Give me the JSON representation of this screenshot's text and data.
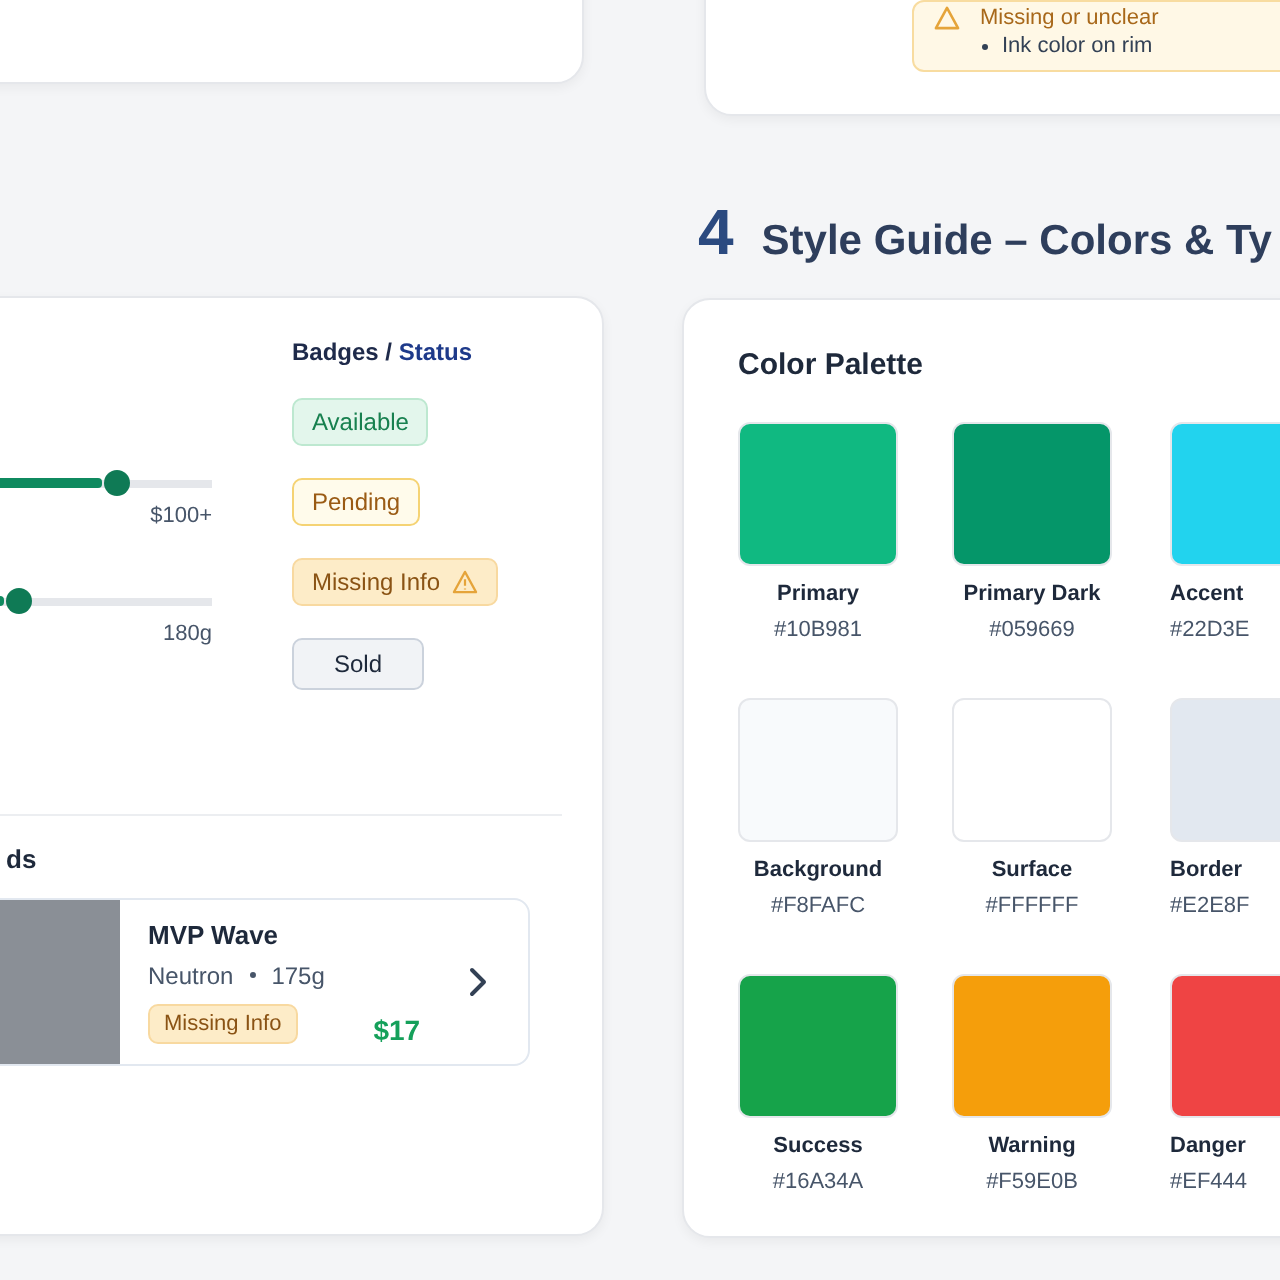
{
  "status_note": {
    "title": "Missing or unclear",
    "items": [
      "Ink color on rim"
    ]
  },
  "filters": {
    "sliders": [
      {
        "level": 0.74,
        "reading": "$100+"
      },
      {
        "level": 0.47,
        "reading": "180g"
      }
    ]
  },
  "badges": {
    "title": "Badges /",
    "title_accent": "Status",
    "items": [
      {
        "label": "Available",
        "kind": "available"
      },
      {
        "label": "Pending",
        "kind": "pending"
      },
      {
        "label": "Missing Info",
        "kind": "missing"
      },
      {
        "label": "Sold",
        "kind": "sold"
      }
    ]
  },
  "listing": {
    "heading": "ds",
    "name": "MVP Wave",
    "plastic": "Neutron",
    "weight": "175g",
    "badge": {
      "label": "Missing Info",
      "kind": "missing"
    },
    "price": "$17"
  },
  "style_guide": {
    "number": "4",
    "title": "Style Guide – Colors & Ty",
    "palette_title": "Color Palette",
    "colors": [
      {
        "name": "Primary",
        "hex": "#10B981",
        "color": "#10b981"
      },
      {
        "name": "Primary Dark",
        "hex": "#059669",
        "color": "#059669"
      },
      {
        "name": "Accent",
        "hex": "#22D3E",
        "color": "#22d3ee"
      },
      {
        "name": "Background",
        "hex": "#F8FAFC",
        "color": "#f8fafc"
      },
      {
        "name": "Surface",
        "hex": "#FFFFFF",
        "color": "#ffffff"
      },
      {
        "name": "Border",
        "hex": "#E2E8F",
        "color": "#e2e8f0"
      },
      {
        "name": "Success",
        "hex": "#16A34A",
        "color": "#16a34a"
      },
      {
        "name": "Warning",
        "hex": "#F59E0B",
        "color": "#f59e0b"
      },
      {
        "name": "Danger",
        "hex": "#EF444",
        "color": "#ef4444"
      }
    ]
  }
}
